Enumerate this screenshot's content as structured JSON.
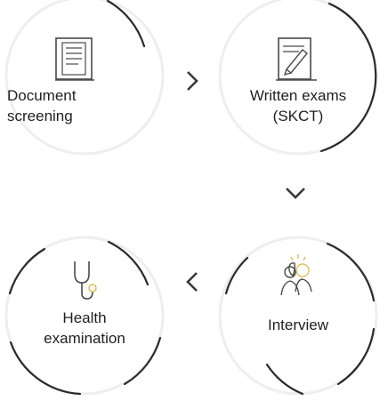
{
  "colors": {
    "ring_track": "#eeeeee",
    "ring_stroke": "#2a2a2a",
    "icon_stroke": "#4a4a4a",
    "icon_accent": "#e0c25a",
    "arrow": "#3a3a3a",
    "text": "#1f1f1f"
  },
  "steps": [
    {
      "line1": "Document",
      "line2": "screening",
      "icon": "document-icon"
    },
    {
      "line1": "Written exams",
      "line2": "(SKCT)",
      "icon": "exam-notepad-icon"
    },
    {
      "line1": "Health",
      "line2": "examination",
      "icon": "stethoscope-icon"
    },
    {
      "line1": "Interview",
      "line2": "",
      "icon": "interview-people-icon"
    }
  ],
  "arrows": [
    {
      "direction": "right",
      "icon": "chevron-right-icon"
    },
    {
      "direction": "down",
      "icon": "chevron-down-icon"
    },
    {
      "direction": "left",
      "icon": "chevron-left-icon"
    }
  ]
}
